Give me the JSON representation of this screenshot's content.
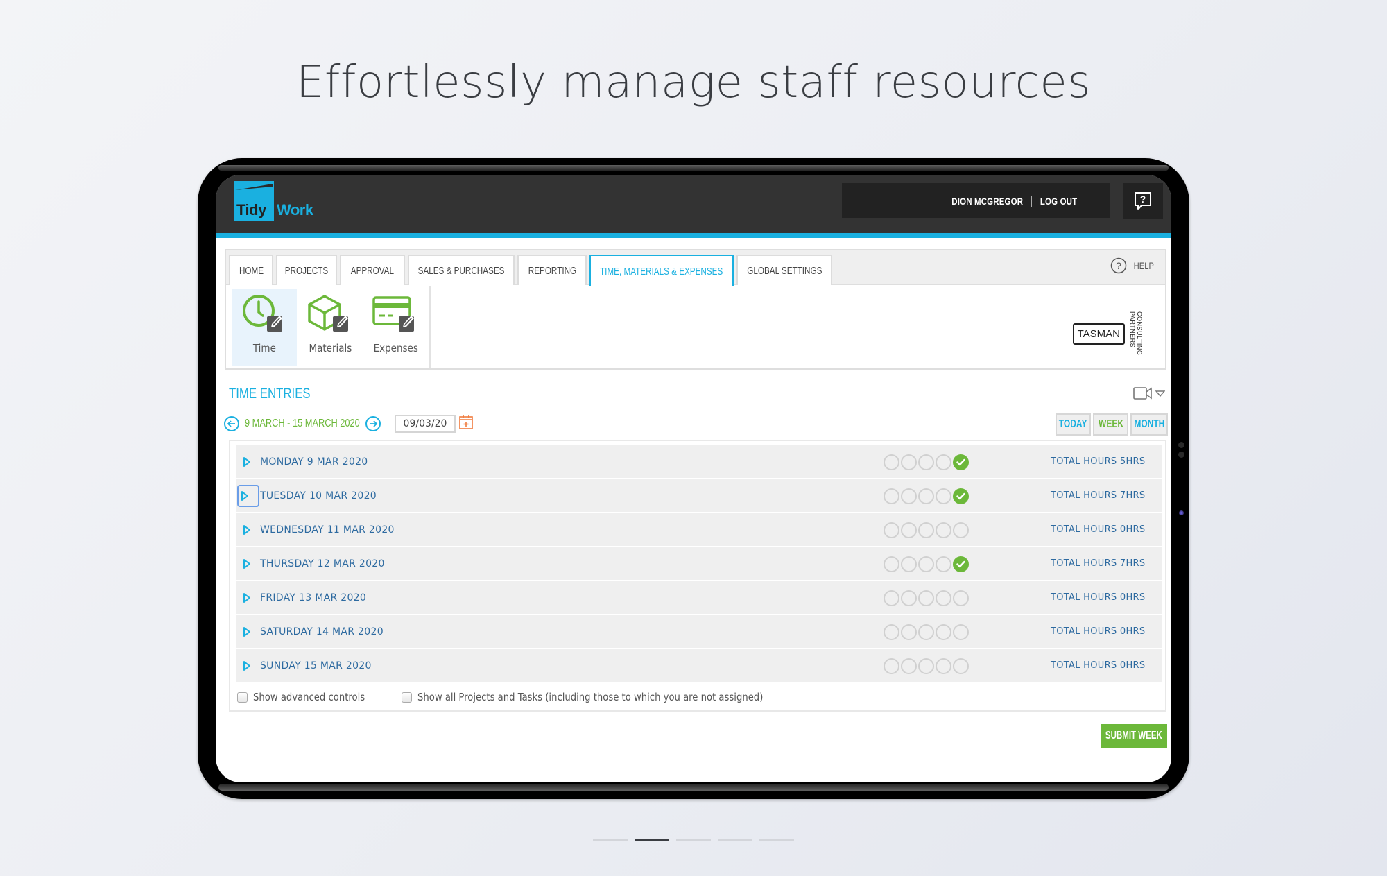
{
  "headline": "Effortlessly manage staff resources",
  "app": {
    "logo": {
      "part1": "Tidy",
      "part2": "Work"
    },
    "user_name": "DION MCGREGOR",
    "logout_label": "LOG OUT",
    "help_icon": "help-chat-icon"
  },
  "nav": {
    "tabs": [
      {
        "label": "HOME",
        "active": false
      },
      {
        "label": "PROJECTS",
        "active": false
      },
      {
        "label": "APPROVAL",
        "active": false
      },
      {
        "label": "SALES & PURCHASES",
        "active": false
      },
      {
        "label": "REPORTING",
        "active": false
      },
      {
        "label": "TIME, MATERIALS & EXPENSES",
        "active": true
      },
      {
        "label": "GLOBAL SETTINGS",
        "active": false
      }
    ],
    "help_label": "HELP",
    "subnav": [
      {
        "label": "Time",
        "icon": "clock-edit-icon",
        "active": true
      },
      {
        "label": "Materials",
        "icon": "box-edit-icon",
        "active": false
      },
      {
        "label": "Expenses",
        "icon": "card-edit-icon",
        "active": false
      }
    ],
    "client_logo": {
      "name": "TASMAN",
      "tagline": "CONSULTING PARTNERS"
    }
  },
  "time_entries": {
    "title": "TIME ENTRIES",
    "date_range": "9 MARCH - 15 MARCH 2020",
    "date_input": "09/03/20",
    "views": [
      {
        "label": "TODAY",
        "color": "#1ab0e0"
      },
      {
        "label": "WEEK",
        "color": "#6cb83a"
      },
      {
        "label": "MONTH",
        "color": "#1ab0e0"
      }
    ],
    "days": [
      {
        "label": "MONDAY 9 MAR 2020",
        "total": "TOTAL HOURS 5HRS",
        "approved_step": 5,
        "focused": false
      },
      {
        "label": "TUESDAY 10 MAR 2020",
        "total": "TOTAL HOURS 7HRS",
        "approved_step": 5,
        "focused": true
      },
      {
        "label": "WEDNESDAY 11 MAR 2020",
        "total": "TOTAL HOURS 0HRS",
        "approved_step": 0,
        "focused": false
      },
      {
        "label": "THURSDAY 12 MAR 2020",
        "total": "TOTAL HOURS 7HRS",
        "approved_step": 5,
        "focused": false
      },
      {
        "label": "FRIDAY 13 MAR 2020",
        "total": "TOTAL HOURS 0HRS",
        "approved_step": 0,
        "focused": false
      },
      {
        "label": "SATURDAY 14 MAR 2020",
        "total": "TOTAL HOURS 0HRS",
        "approved_step": 0,
        "focused": false
      },
      {
        "label": "SUNDAY 15 MAR 2020",
        "total": "TOTAL HOURS 0HRS",
        "approved_step": 0,
        "focused": false
      }
    ],
    "options": [
      {
        "label": "Show advanced controls",
        "checked": false
      },
      {
        "label": "Show all Projects and Tasks (including those to which you are not assigned)",
        "checked": false
      }
    ],
    "submit_label": "SUBMIT WEEK"
  },
  "pager": {
    "count": 5,
    "active_index": 1
  },
  "colors": {
    "brand_blue": "#1ab0e0",
    "green": "#6cb83a",
    "header_dark": "#333333"
  }
}
